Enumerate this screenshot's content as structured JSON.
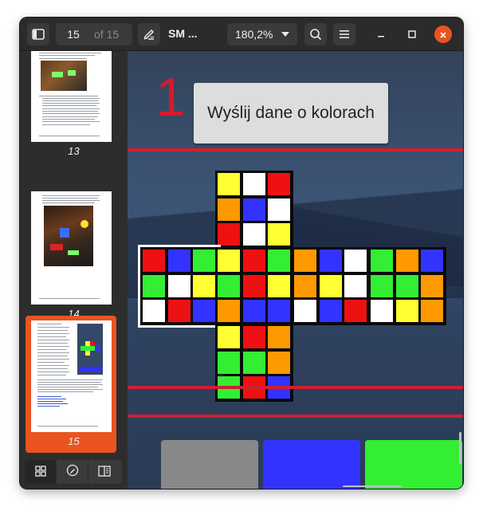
{
  "header": {
    "page_current": "15",
    "page_total_label": "of 15",
    "title": "SM ...",
    "zoom": "180,2%"
  },
  "sidebar": {
    "thumbnails": [
      {
        "label": "13"
      },
      {
        "label": "14"
      },
      {
        "label": "15",
        "selected": true
      }
    ]
  },
  "document": {
    "step_number": "1",
    "send_button_label": "Wyślij dane o kolorach",
    "cube": {
      "colors": {
        "Y": "#ffff33",
        "W": "#ffffff",
        "R": "#ee1111",
        "O": "#ff9900",
        "B": "#3333ff",
        "G": "#33ee33"
      },
      "faces": [
        {
          "name": "top",
          "cells": [
            "Y",
            "W",
            "R",
            "O",
            "B",
            "W",
            "R",
            "W",
            "Y"
          ]
        },
        {
          "name": "left",
          "cells": [
            "R",
            "B",
            "G",
            "G",
            "W",
            "Y",
            "W",
            "R",
            "B"
          ],
          "highlighted": true
        },
        {
          "name": "front",
          "cells": [
            "Y",
            "R",
            "G",
            "G",
            "R",
            "Y",
            "O",
            "B",
            "B"
          ]
        },
        {
          "name": "right",
          "cells": [
            "O",
            "B",
            "W",
            "O",
            "Y",
            "W",
            "W",
            "B",
            "R"
          ]
        },
        {
          "name": "back",
          "cells": [
            "G",
            "O",
            "B",
            "G",
            "G",
            "O",
            "W",
            "Y",
            "O"
          ]
        },
        {
          "name": "bottom",
          "cells": [
            "Y",
            "R",
            "O",
            "G",
            "G",
            "O",
            "G",
            "R",
            "B"
          ]
        }
      ]
    },
    "bottom_tiles": [
      {
        "name": "gray-tile",
        "color": "#888888"
      },
      {
        "name": "blue-tile",
        "color": "#3333ff"
      },
      {
        "name": "green-tile",
        "color": "#33ee33"
      }
    ]
  },
  "colors": {
    "accent": "#e95420"
  }
}
